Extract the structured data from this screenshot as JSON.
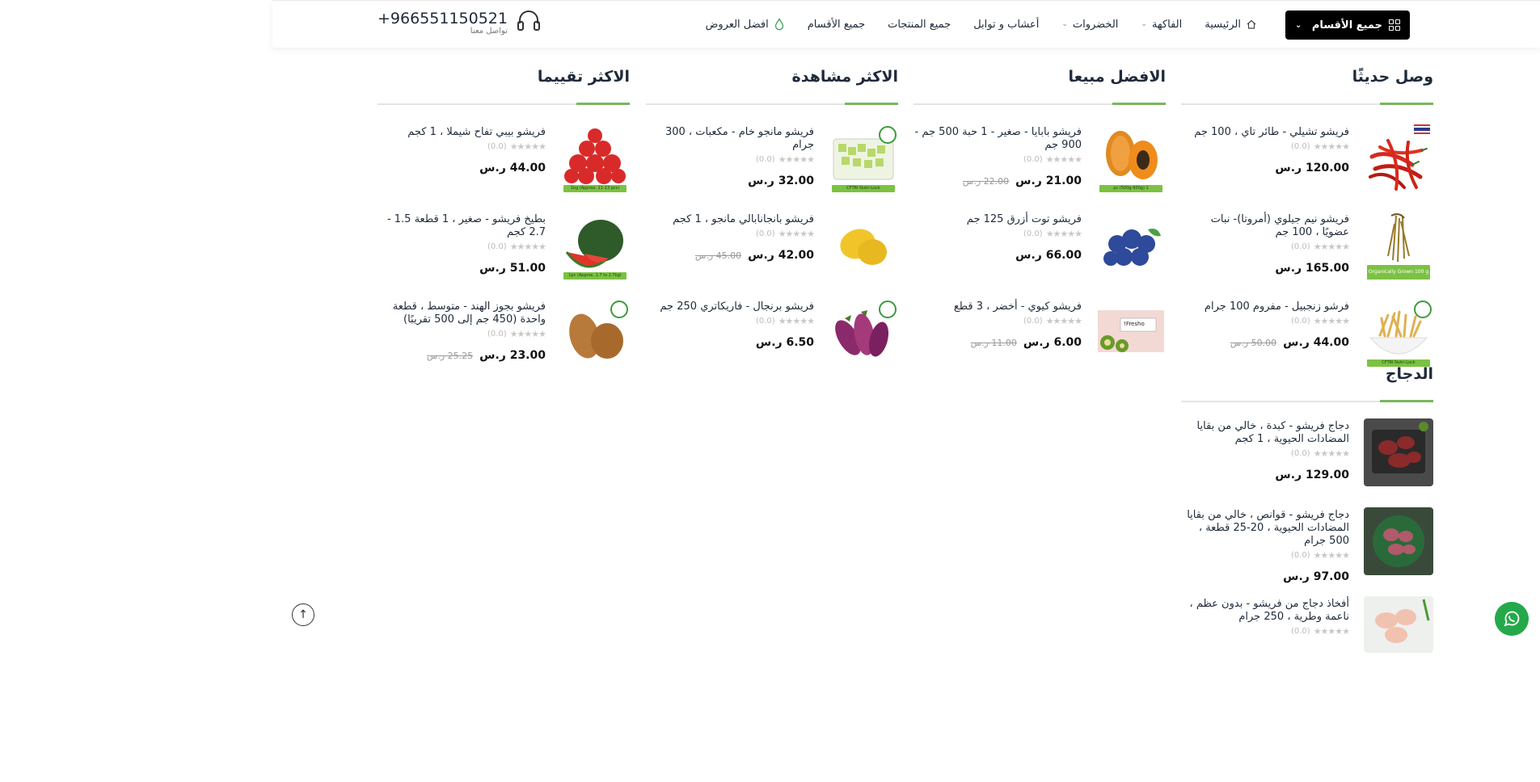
{
  "header": {
    "all_categories_button": "جميع الأقسام",
    "nav": {
      "home": "الرئيسية",
      "fruits": "الفاكهة",
      "vegetables": "الخضروات",
      "herbs": "أعشاب و توابل",
      "all_products": "جميع المنتجات",
      "all_sections": "جميع الأقسام",
      "best_offers": "افضل العروض"
    },
    "phone": "+966551150521",
    "contact_label": "تواصل معنا"
  },
  "columns": {
    "new_arrivals": {
      "title": "وصل حديثًا",
      "items": [
        {
          "name": "فريشو تشيلي - طائر تاي ، 100 جم",
          "rating": "(0.0)",
          "price": "120.00 ر.س",
          "old_price": ""
        },
        {
          "name": "فريشو نيم جيلوي (أمروتا)- نبات عضويًا ، 100 جم",
          "rating": "(0.0)",
          "price": "165.00 ر.س",
          "old_price": "",
          "badge": "Organically Grown 100 g"
        },
        {
          "name": "فرشو زنجبيل - مفروم 100 جرام",
          "rating": "(0.0)",
          "price": "44.00 ر.س",
          "old_price": "50.00 ر.س",
          "badge": "CFTRI Nutri-Lock"
        }
      ]
    },
    "best_selling": {
      "title": "الافضل مبيعا",
      "items": [
        {
          "name": "فريشو بابايا - صغير - 1 حبة 500 جم - 900 جم",
          "rating": "(0.0)",
          "price": "21.00 ر.س",
          "old_price": "22.00 ر.س",
          "badge": "1 pc (500g-900g)"
        },
        {
          "name": "فريشو توت أزرق 125 جم",
          "rating": "(0.0)",
          "price": "66.00 ر.س",
          "old_price": ""
        },
        {
          "name": "فريشو كيوي - أخضر ، 3 قطع",
          "rating": "(0.0)",
          "price": "6.00 ر.س",
          "old_price": "11.00 ر.س",
          "badge": "Fresho!"
        }
      ]
    },
    "most_viewed": {
      "title": "الاكثر مشاهدة",
      "items": [
        {
          "name": "فريشو مانجو خام - مكعبات ، 300 جرام",
          "rating": "(0.0)",
          "price": "32.00 ر.س",
          "old_price": "",
          "badge": "CFTRI Nutri-Lock"
        },
        {
          "name": "فريشو بانجانابالي مانجو ، 1 كجم",
          "rating": "(0.0)",
          "price": "42.00 ر.س",
          "old_price": "45.00 ر.س"
        },
        {
          "name": "فريشو برنجال - فاريكاتري 250 جم",
          "rating": "(0.0)",
          "price": "6.50 ر.س",
          "old_price": ""
        }
      ]
    },
    "top_rated": {
      "title": "الاكثر تقييما",
      "items": [
        {
          "name": "فريشو بيبي تفاح شيملا ، 1 كجم",
          "rating": "(0.0)",
          "price": "44.00 ر.س",
          "old_price": "",
          "badge": "1kg (Approx. 11-13 pcs)"
        },
        {
          "name": "بطيخ فريشو - صغير ، 1 قطعة 1.5 - 2.7 كجم",
          "rating": "(0.0)",
          "price": "51.00 ر.س",
          "old_price": "",
          "badge": "1pc (Approx. 1.7 to 2.7kg)"
        },
        {
          "name": "فريشو بجوز الهند - متوسط ، قطعة واحدة (450 جم إلى 500 تقريبًا)",
          "rating": "(0.0)",
          "price": "23.00 ر.س",
          "old_price": "25.25 ر.س"
        }
      ]
    },
    "chicken": {
      "title": "الدجاج",
      "items": [
        {
          "name": "دجاج فريشو - كبدة ، خالي من بقايا المضادات الحيوية ، 1 كجم",
          "rating": "(0.0)",
          "price": "129.00 ر.س",
          "old_price": ""
        },
        {
          "name": "دجاج فريشو - قوانص ، خالي من بقايا المضادات الحيوية ، 20-25 قطعة ، 500 جرام",
          "rating": "(0.0)",
          "price": "97.00 ر.س",
          "old_price": ""
        },
        {
          "name": "أفخاذ دجاج من فريشو - بدون عظم ، ناعمة وطرية ، 250 جرام",
          "rating": "(0.0)",
          "price": "",
          "old_price": ""
        }
      ]
    }
  },
  "colors": {
    "accent_green": "#6ab04c",
    "whatsapp": "#25a84a",
    "dark_button": "#000000"
  },
  "icons": {
    "scroll_top": "arrow-up-circle-icon",
    "whatsapp": "whatsapp-icon",
    "headset": "headset-icon"
  }
}
